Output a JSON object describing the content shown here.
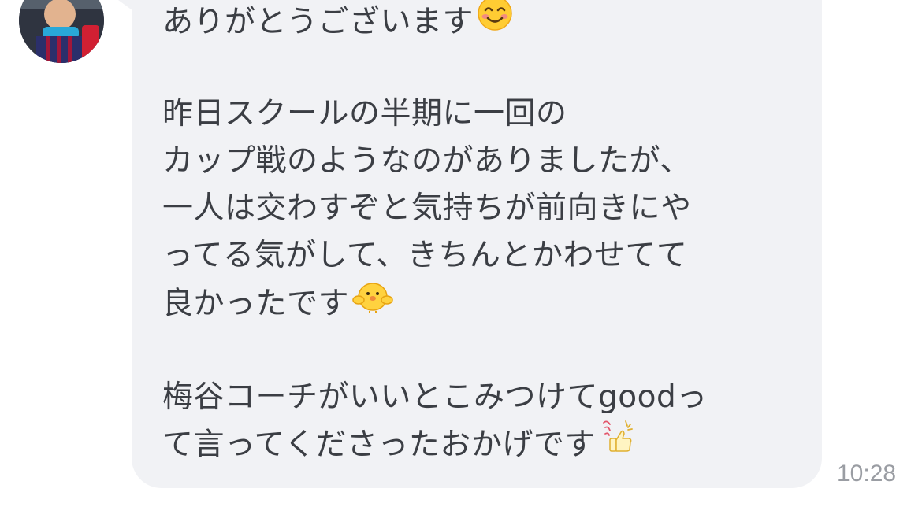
{
  "message": {
    "lines": [
      "ありがとうございます",
      "",
      "昨日スクールの半期に一回の",
      "カップ戦のようなのがありましたが、",
      "一人は交わすぞと気持ちが前向きにや",
      "ってる気がして、きちんとかわせてて",
      "良かったです",
      "",
      "梅谷コーチがいいとこみつけてgoodっ",
      "て言ってくださったおかげです"
    ],
    "emojis": {
      "line0": "smiling-face-emoji",
      "line6": "yellow-chick-sticker-emoji",
      "line9": "thumbs-up-good-sticker-emoji"
    }
  },
  "timestamp": "10:28",
  "colors": {
    "bubble": "#f1f2f5",
    "text": "#3b3e44",
    "timestamp": "#9a9da3",
    "background": "#ffffff"
  }
}
